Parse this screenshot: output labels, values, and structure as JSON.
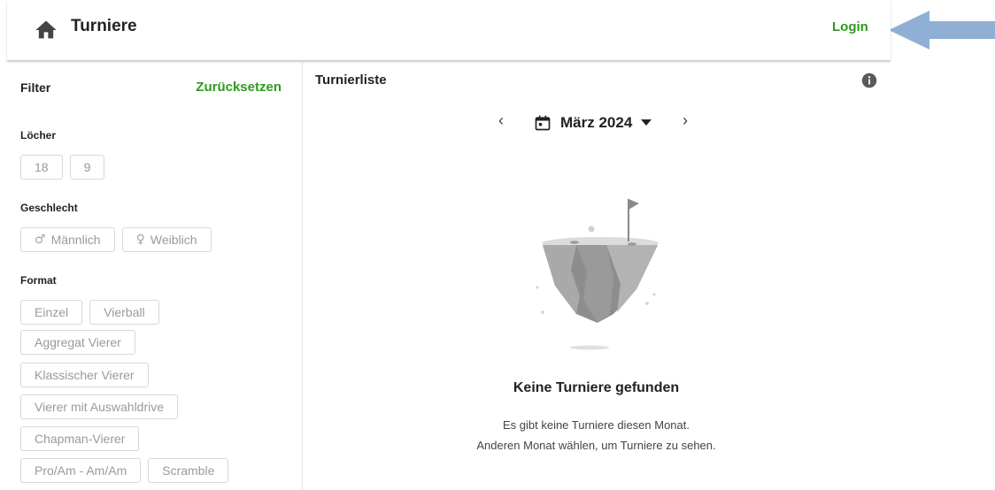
{
  "header": {
    "title": "Turniere",
    "login_label": "Login"
  },
  "sidebar": {
    "filter_title": "Filter",
    "reset_label": "Zurücksetzen",
    "holes": {
      "label": "Löcher",
      "options": [
        "18",
        "9"
      ]
    },
    "gender": {
      "label": "Geschlecht",
      "options": [
        {
          "symbol": "♂",
          "label": "Männlich"
        },
        {
          "symbol": "♀",
          "label": "Weiblich"
        }
      ]
    },
    "format": {
      "label": "Format",
      "options": [
        "Einzel",
        "Vierball",
        "Aggregat Vierer",
        "Klassischer Vierer",
        "Vierer mit Auswahldrive",
        "Chapman-Vierer",
        "Pro/Am - Am/Am",
        "Scramble"
      ]
    }
  },
  "main": {
    "list_title": "Turnierliste",
    "month_nav": {
      "prev": "‹",
      "next": "›",
      "month": "März 2024"
    },
    "empty": {
      "title": "Keine Turniere gefunden",
      "line1": "Es gibt keine Turniere diesen Monat.",
      "line2": "Anderen Monat wählen, um Turniere zu sehen."
    }
  },
  "icons": {
    "home": "home-icon",
    "info": "info-icon",
    "calendar": "calendar-icon",
    "dropdown": "caret-down-icon",
    "annotation": "arrow-left-icon"
  },
  "colors": {
    "accent": "#2e9a1e",
    "chip_border": "#d8d8d8",
    "chip_text": "#9a9a9a",
    "arrow": "#8fb0d4"
  }
}
